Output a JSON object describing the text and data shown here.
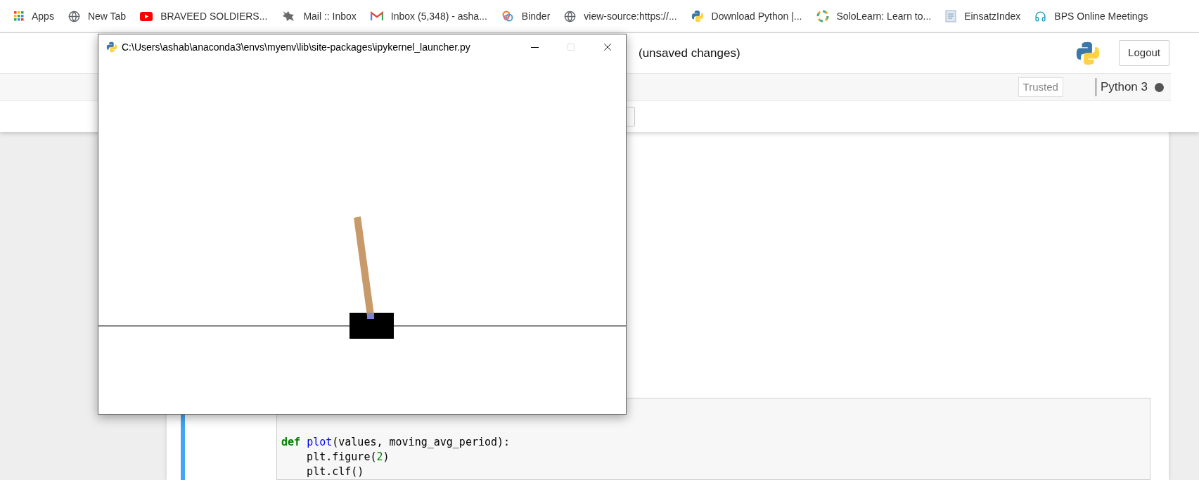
{
  "bookmarks": [
    {
      "label": "Apps"
    },
    {
      "label": "New Tab"
    },
    {
      "label": "BRAVEED SOLDIERS..."
    },
    {
      "label": "Mail :: Inbox"
    },
    {
      "label": "Inbox (5,348) - asha..."
    },
    {
      "label": "Binder"
    },
    {
      "label": "view-source:https://..."
    },
    {
      "label": "Download Python |..."
    },
    {
      "label": "SoloLearn: Learn to..."
    },
    {
      "label": "EinsatzIndex"
    },
    {
      "label": "BPS Online Meetings"
    }
  ],
  "notebook": {
    "save_status": "(unsaved changes)",
    "logout": "Logout",
    "trusted": "Trusted",
    "kernel": "Python 3",
    "kernel_busy": true
  },
  "code_cell": {
    "lines": [
      [
        {
          "kind": "keyword",
          "text": "def "
        },
        {
          "kind": "name",
          "text": "plot"
        },
        {
          "kind": "plain",
          "text": "(values, moving_avg_period):"
        }
      ],
      [
        {
          "kind": "plain",
          "text": "    plt.figure("
        },
        {
          "kind": "number",
          "text": "2"
        },
        {
          "kind": "plain",
          "text": ")"
        }
      ],
      [
        {
          "kind": "plain",
          "text": "    plt.clf()"
        }
      ]
    ]
  },
  "render_window": {
    "title": "C:\\Users\\ashab\\anaconda3\\envs\\myenv\\lib\\site-packages\\ipykernel_launcher.py"
  }
}
